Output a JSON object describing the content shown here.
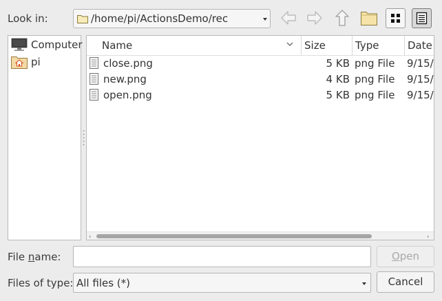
{
  "look_in": {
    "label": "Look in:",
    "path": "/home/pi/ActionsDemo/rec"
  },
  "toolbar": {
    "back": "back-arrow-icon",
    "forward": "forward-arrow-icon",
    "up": "up-arrow-icon",
    "new_folder": "new-folder-icon",
    "icon_view": "icon-view-icon",
    "detail_view": "detail-view-icon"
  },
  "sidebar": {
    "items": [
      {
        "label": "Computer",
        "icon": "computer-icon"
      },
      {
        "label": "pi",
        "icon": "home-folder-icon"
      }
    ]
  },
  "file_list": {
    "columns": [
      "Name",
      "Size",
      "Type",
      "Date"
    ],
    "rows": [
      {
        "name": "close.png",
        "size": "5 KB",
        "type": "png File",
        "date": "9/15/"
      },
      {
        "name": "new.png",
        "size": "4 KB",
        "type": "png File",
        "date": "9/15/"
      },
      {
        "name": "open.png",
        "size": "5 KB",
        "type": "png File",
        "date": "9/15/"
      }
    ]
  },
  "file_name": {
    "label_pre": "File ",
    "label_u": "n",
    "label_post": "ame:",
    "value": ""
  },
  "file_type": {
    "label": "Files of type:",
    "value": "All files (*)"
  },
  "buttons": {
    "open_u": "O",
    "open_rest": "pen",
    "cancel": "Cancel"
  }
}
